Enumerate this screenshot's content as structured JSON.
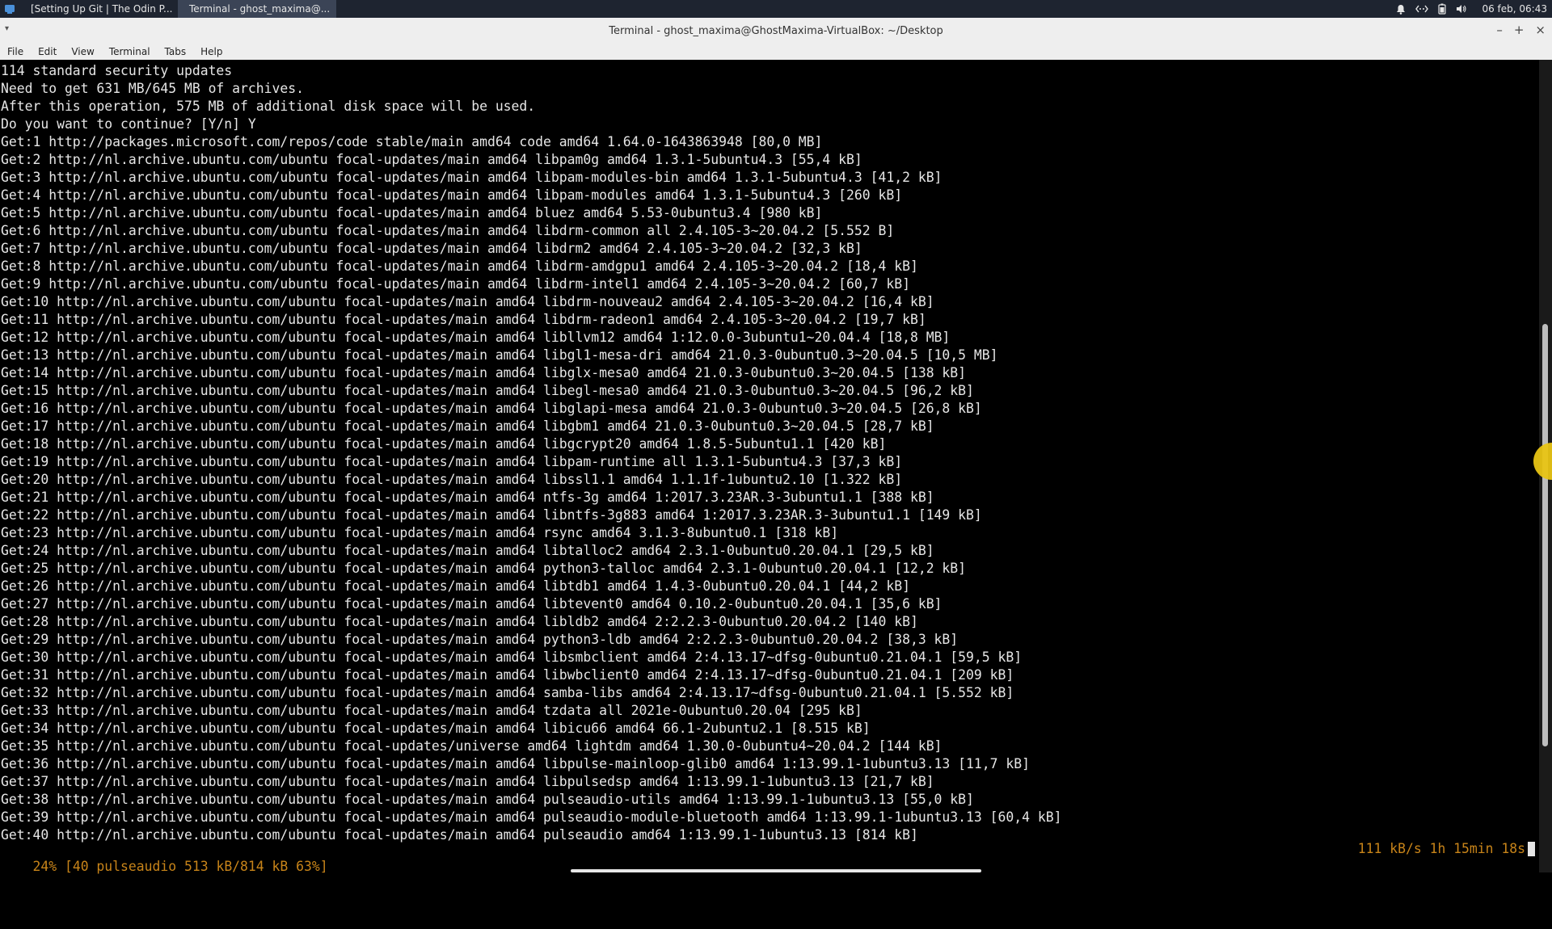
{
  "panel": {
    "tasks": [
      {
        "label": "[Setting Up Git | The Odin P...",
        "icon": "firefox-icon"
      },
      {
        "label": "Terminal - ghost_maxima@...",
        "icon": "terminal-icon"
      }
    ],
    "clock": "06 feb, 06:43",
    "tray_icons": [
      "notification-bell-icon",
      "network-icon",
      "battery-icon",
      "volume-icon"
    ]
  },
  "window": {
    "title": "Terminal - ghost_maxima@GhostMaxima-VirtualBox: ~/Desktop"
  },
  "menubar": {
    "items": [
      "File",
      "Edit",
      "View",
      "Terminal",
      "Tabs",
      "Help"
    ]
  },
  "terminal": {
    "lines": [
      "114 standard security updates",
      "Need to get 631 MB/645 MB of archives.",
      "After this operation, 575 MB of additional disk space will be used.",
      "Do you want to continue? [Y/n] Y",
      "Get:1 http://packages.microsoft.com/repos/code stable/main amd64 code amd64 1.64.0-1643863948 [80,0 MB]",
      "Get:2 http://nl.archive.ubuntu.com/ubuntu focal-updates/main amd64 libpam0g amd64 1.3.1-5ubuntu4.3 [55,4 kB]",
      "Get:3 http://nl.archive.ubuntu.com/ubuntu focal-updates/main amd64 libpam-modules-bin amd64 1.3.1-5ubuntu4.3 [41,2 kB]",
      "Get:4 http://nl.archive.ubuntu.com/ubuntu focal-updates/main amd64 libpam-modules amd64 1.3.1-5ubuntu4.3 [260 kB]",
      "Get:5 http://nl.archive.ubuntu.com/ubuntu focal-updates/main amd64 bluez amd64 5.53-0ubuntu3.4 [980 kB]",
      "Get:6 http://nl.archive.ubuntu.com/ubuntu focal-updates/main amd64 libdrm-common all 2.4.105-3~20.04.2 [5.552 B]",
      "Get:7 http://nl.archive.ubuntu.com/ubuntu focal-updates/main amd64 libdrm2 amd64 2.4.105-3~20.04.2 [32,3 kB]",
      "Get:8 http://nl.archive.ubuntu.com/ubuntu focal-updates/main amd64 libdrm-amdgpu1 amd64 2.4.105-3~20.04.2 [18,4 kB]",
      "Get:9 http://nl.archive.ubuntu.com/ubuntu focal-updates/main amd64 libdrm-intel1 amd64 2.4.105-3~20.04.2 [60,7 kB]",
      "Get:10 http://nl.archive.ubuntu.com/ubuntu focal-updates/main amd64 libdrm-nouveau2 amd64 2.4.105-3~20.04.2 [16,4 kB]",
      "Get:11 http://nl.archive.ubuntu.com/ubuntu focal-updates/main amd64 libdrm-radeon1 amd64 2.4.105-3~20.04.2 [19,7 kB]",
      "Get:12 http://nl.archive.ubuntu.com/ubuntu focal-updates/main amd64 libllvm12 amd64 1:12.0.0-3ubuntu1~20.04.4 [18,8 MB]",
      "Get:13 http://nl.archive.ubuntu.com/ubuntu focal-updates/main amd64 libgl1-mesa-dri amd64 21.0.3-0ubuntu0.3~20.04.5 [10,5 MB]",
      "Get:14 http://nl.archive.ubuntu.com/ubuntu focal-updates/main amd64 libglx-mesa0 amd64 21.0.3-0ubuntu0.3~20.04.5 [138 kB]",
      "Get:15 http://nl.archive.ubuntu.com/ubuntu focal-updates/main amd64 libegl-mesa0 amd64 21.0.3-0ubuntu0.3~20.04.5 [96,2 kB]",
      "Get:16 http://nl.archive.ubuntu.com/ubuntu focal-updates/main amd64 libglapi-mesa amd64 21.0.3-0ubuntu0.3~20.04.5 [26,8 kB]",
      "Get:17 http://nl.archive.ubuntu.com/ubuntu focal-updates/main amd64 libgbm1 amd64 21.0.3-0ubuntu0.3~20.04.5 [28,7 kB]",
      "Get:18 http://nl.archive.ubuntu.com/ubuntu focal-updates/main amd64 libgcrypt20 amd64 1.8.5-5ubuntu1.1 [420 kB]",
      "Get:19 http://nl.archive.ubuntu.com/ubuntu focal-updates/main amd64 libpam-runtime all 1.3.1-5ubuntu4.3 [37,3 kB]",
      "Get:20 http://nl.archive.ubuntu.com/ubuntu focal-updates/main amd64 libssl1.1 amd64 1.1.1f-1ubuntu2.10 [1.322 kB]",
      "Get:21 http://nl.archive.ubuntu.com/ubuntu focal-updates/main amd64 ntfs-3g amd64 1:2017.3.23AR.3-3ubuntu1.1 [388 kB]",
      "Get:22 http://nl.archive.ubuntu.com/ubuntu focal-updates/main amd64 libntfs-3g883 amd64 1:2017.3.23AR.3-3ubuntu1.1 [149 kB]",
      "Get:23 http://nl.archive.ubuntu.com/ubuntu focal-updates/main amd64 rsync amd64 3.1.3-8ubuntu0.1 [318 kB]",
      "Get:24 http://nl.archive.ubuntu.com/ubuntu focal-updates/main amd64 libtalloc2 amd64 2.3.1-0ubuntu0.20.04.1 [29,5 kB]",
      "Get:25 http://nl.archive.ubuntu.com/ubuntu focal-updates/main amd64 python3-talloc amd64 2.3.1-0ubuntu0.20.04.1 [12,2 kB]",
      "Get:26 http://nl.archive.ubuntu.com/ubuntu focal-updates/main amd64 libtdb1 amd64 1.4.3-0ubuntu0.20.04.1 [44,2 kB]",
      "Get:27 http://nl.archive.ubuntu.com/ubuntu focal-updates/main amd64 libtevent0 amd64 0.10.2-0ubuntu0.20.04.1 [35,6 kB]",
      "Get:28 http://nl.archive.ubuntu.com/ubuntu focal-updates/main amd64 libldb2 amd64 2:2.2.3-0ubuntu0.20.04.2 [140 kB]",
      "Get:29 http://nl.archive.ubuntu.com/ubuntu focal-updates/main amd64 python3-ldb amd64 2:2.2.3-0ubuntu0.20.04.2 [38,3 kB]",
      "Get:30 http://nl.archive.ubuntu.com/ubuntu focal-updates/main amd64 libsmbclient amd64 2:4.13.17~dfsg-0ubuntu0.21.04.1 [59,5 kB]",
      "Get:31 http://nl.archive.ubuntu.com/ubuntu focal-updates/main amd64 libwbclient0 amd64 2:4.13.17~dfsg-0ubuntu0.21.04.1 [209 kB]",
      "Get:32 http://nl.archive.ubuntu.com/ubuntu focal-updates/main amd64 samba-libs amd64 2:4.13.17~dfsg-0ubuntu0.21.04.1 [5.552 kB]",
      "Get:33 http://nl.archive.ubuntu.com/ubuntu focal-updates/main amd64 tzdata all 2021e-0ubuntu0.20.04 [295 kB]",
      "Get:34 http://nl.archive.ubuntu.com/ubuntu focal-updates/main amd64 libicu66 amd64 66.1-2ubuntu2.1 [8.515 kB]",
      "Get:35 http://nl.archive.ubuntu.com/ubuntu focal-updates/universe amd64 lightdm amd64 1.30.0-0ubuntu4~20.04.2 [144 kB]",
      "Get:36 http://nl.archive.ubuntu.com/ubuntu focal-updates/main amd64 libpulse-mainloop-glib0 amd64 1:13.99.1-1ubuntu3.13 [11,7 kB]",
      "Get:37 http://nl.archive.ubuntu.com/ubuntu focal-updates/main amd64 libpulsedsp amd64 1:13.99.1-1ubuntu3.13 [21,7 kB]",
      "Get:38 http://nl.archive.ubuntu.com/ubuntu focal-updates/main amd64 pulseaudio-utils amd64 1:13.99.1-1ubuntu3.13 [55,0 kB]",
      "Get:39 http://nl.archive.ubuntu.com/ubuntu focal-updates/main amd64 pulseaudio-module-bluetooth amd64 1:13.99.1-1ubuntu3.13 [60,4 kB]",
      "Get:40 http://nl.archive.ubuntu.com/ubuntu focal-updates/main amd64 pulseaudio amd64 1:13.99.1-1ubuntu3.13 [814 kB]"
    ],
    "status_left": "24% [40 pulseaudio 513 kB/814 kB 63%]",
    "status_right": "111 kB/s 1h 15min 18s"
  },
  "scrollbar": {
    "position_fraction": 0.48,
    "visible_fraction": 0.52
  },
  "colors": {
    "terminal_bg": "#000000",
    "terminal_fg": "#e6e6e6",
    "progress_fg": "#c88419",
    "panel_bg": "#1e2430"
  }
}
